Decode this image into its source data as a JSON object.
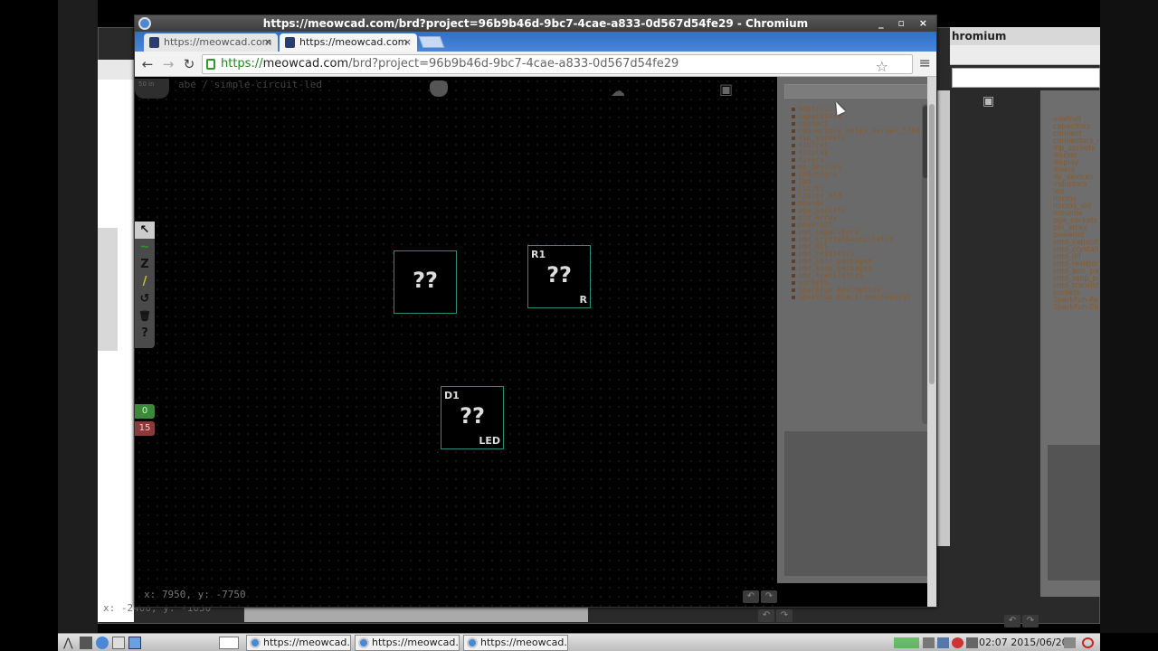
{
  "window": {
    "title": "https://meowcad.com/brd?project=96b9b46d-9bc7-4cae-a833-0d567d54fe29 - Chromium",
    "controls": "_ ▫ ×"
  },
  "background_window": {
    "title": "hromium",
    "status": "x: -2400, y: -1050"
  },
  "tabs": [
    {
      "label": "https://meowcad.com",
      "close": "×"
    },
    {
      "label": "https://meowcad.com",
      "close": "×"
    }
  ],
  "toolbar": {
    "back": "←",
    "forward": "→",
    "reload": "↻",
    "url_scheme": "https://",
    "url_host": "meowcad.com",
    "url_rest": "/brd?project=96b9b46d-9bc7-4cae-a833-0d567d54fe29",
    "star": "☆",
    "menu": "≡"
  },
  "canvas": {
    "project_title": "abe / simple-circuit-led",
    "zoom_badge": "50 in",
    "coords": "x: 7950, y: -7750",
    "undo": "↶",
    "redo": "↷"
  },
  "tools": [
    {
      "name": "select-tool",
      "glyph": "↖"
    },
    {
      "name": "route-tool",
      "glyph": "~"
    },
    {
      "name": "zone-tool",
      "glyph": "Z"
    },
    {
      "name": "line-tool",
      "glyph": "/"
    },
    {
      "name": "rotate-tool",
      "glyph": "↺"
    },
    {
      "name": "delete-tool",
      "glyph": "🗑"
    },
    {
      "name": "help-tool",
      "glyph": "?"
    }
  ],
  "layers": {
    "top": "0",
    "bottom": "15"
  },
  "components": [
    {
      "ref": "",
      "label": "??",
      "value": ""
    },
    {
      "ref": "R1",
      "label": "??",
      "value": "R"
    },
    {
      "ref": "D1",
      "label": "??",
      "value": "LED"
    }
  ],
  "library": [
    "adafruit",
    "capacitors",
    "connect",
    "connectors_molex_serial_53047",
    "dip_sockets",
    "discret",
    "display",
    "divers",
    "dp_devices",
    "inductors",
    "led",
    "libcms",
    "libcms_old",
    "mounde",
    "pga_sockets",
    "pin_array",
    "powerint",
    "smd_capacitors",
    "smd_crystal&oscillator",
    "smd_dil",
    "smd_resistors",
    "smd_soic_packages",
    "smd_ssop_packages",
    "smd_transistors",
    "sockets",
    "SparkFun-Aesthetics",
    "SparkFun-Electromechanical"
  ],
  "taskbar": {
    "tasks": [
      "https://meowcad...",
      "https://meowcad...",
      "https://meowcad..."
    ],
    "clock": "02:07 2015/06/20"
  },
  "colors": {
    "component_border": "#2a8d82",
    "layer_top": "#3a8a3a",
    "layer_bottom": "#8a3a3a",
    "library_text": "#8a5a2a"
  }
}
